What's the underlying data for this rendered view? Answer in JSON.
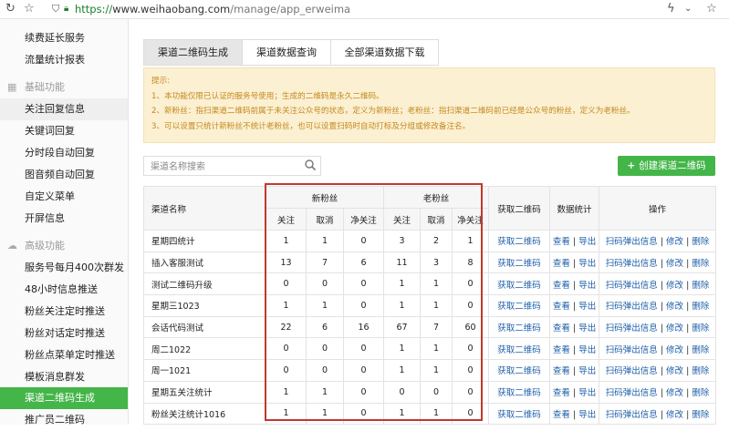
{
  "browser": {
    "url_scheme": "https://",
    "url_host": "www.weihaobang.com",
    "url_path": "/manage/app_erweima"
  },
  "sidebar": {
    "items_top": [
      "续费延长服务",
      "流量统计报表"
    ],
    "group_basic": "基础功能",
    "items_basic": [
      "关注回复信息",
      "关键词回复",
      "分时段自动回复",
      "图音频自动回复",
      "自定义菜单",
      "开屏信息"
    ],
    "group_adv": "高级功能",
    "items_adv": [
      "服务号每月400次群发",
      "48小时信息推送",
      "粉丝关注定时推送",
      "粉丝对话定时推送",
      "粉丝点菜单定时推送",
      "模板消息群发",
      "渠道二维码生成",
      "推广员二维码"
    ],
    "active": "渠道二维码生成"
  },
  "tabs": [
    "渠道二维码生成",
    "渠道数据查询",
    "全部渠道数据下载"
  ],
  "tip": {
    "title": "提示:",
    "lines": [
      "1、本功能仅限已认证的服务号使用；生成的二维码是永久二维码。",
      "2、新粉丝：指扫渠道二维码前属于未关注公众号的状态，定义为新粉丝；老粉丝：指扫渠道二维码前已经是公众号的粉丝，定义为老粉丝。",
      "3、可以设置只统计新粉丝不统计老粉丝，也可以设置扫码时自动打标及分组或修改备注名。"
    ]
  },
  "search": {
    "placeholder": "渠道名称搜索"
  },
  "new_button": {
    "label": "创建渠道二维码"
  },
  "table": {
    "headers": {
      "name": "渠道名称",
      "new_fans": "新粉丝",
      "old_fans": "老粉丝",
      "get_qr": "获取二维码",
      "stats": "数据统计",
      "ops": "操作",
      "sub_follow": "关注",
      "sub_cancel": "取消",
      "sub_net": "净关注"
    },
    "link_get_qr": "获取二维码",
    "link_view": "查看",
    "link_export": "导出",
    "link_scan_msg": "扫码弹出信息",
    "link_edit": "修改",
    "link_delete": "删除",
    "sep": "|",
    "rows": [
      {
        "name": "星期四统计",
        "n": [
          "1",
          "1",
          "0"
        ],
        "o": [
          "3",
          "2",
          "1"
        ]
      },
      {
        "name": "插入客服测试",
        "n": [
          "13",
          "7",
          "6"
        ],
        "o": [
          "11",
          "3",
          "8"
        ]
      },
      {
        "name": "测试二维码升级",
        "n": [
          "0",
          "0",
          "0"
        ],
        "o": [
          "1",
          "1",
          "0"
        ]
      },
      {
        "name": "星期三1023",
        "n": [
          "1",
          "1",
          "0"
        ],
        "o": [
          "1",
          "1",
          "0"
        ]
      },
      {
        "name": "会话代码测试",
        "n": [
          "22",
          "6",
          "16"
        ],
        "o": [
          "67",
          "7",
          "60"
        ]
      },
      {
        "name": "周二1022",
        "n": [
          "0",
          "0",
          "0"
        ],
        "o": [
          "1",
          "1",
          "0"
        ]
      },
      {
        "name": "周一1021",
        "n": [
          "0",
          "0",
          "0"
        ],
        "o": [
          "1",
          "1",
          "0"
        ]
      },
      {
        "name": "星期五关注统计",
        "n": [
          "1",
          "1",
          "0"
        ],
        "o": [
          "0",
          "0",
          "0"
        ]
      },
      {
        "name": "粉丝关注统计1016",
        "n": [
          "1",
          "1",
          "0"
        ],
        "o": [
          "1",
          "1",
          "0"
        ]
      }
    ]
  },
  "colors": {
    "accent": "#44b549",
    "link": "#1f5fa8",
    "highlight_box": "#c0392b",
    "tip_text": "#c5891e"
  }
}
